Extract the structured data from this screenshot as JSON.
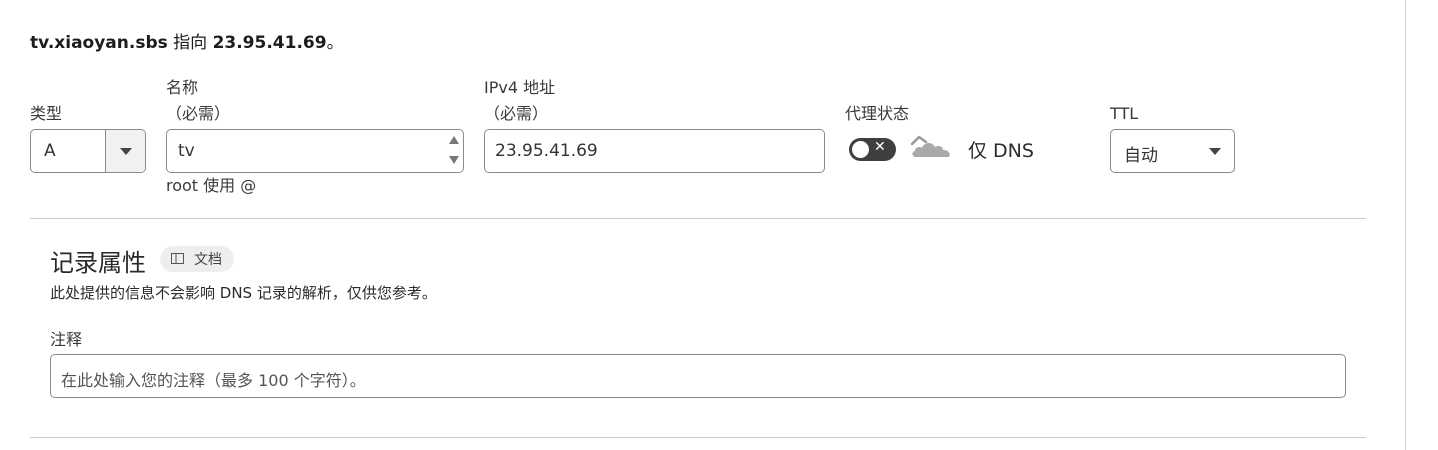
{
  "summary": {
    "host": "tv.xiaoyan.sbs",
    "points_to": "指向",
    "ip": "23.95.41.69",
    "end": "。"
  },
  "type_field": {
    "label": "类型",
    "value": "A",
    "icon": "chevron-down-icon"
  },
  "name_field": {
    "label": "名称",
    "required": "（必需）",
    "value": "tv",
    "hint": "root 使用 @",
    "icon": "spinner-arrows-icon"
  },
  "ipv4_field": {
    "label": "IPv4 地址",
    "required": "（必需）",
    "value": "23.95.41.69"
  },
  "proxy": {
    "label": "代理状态",
    "toggle_off_symbol": "✕",
    "status_text": "仅 DNS",
    "cloud_color": "#9a9a9a",
    "enabled": false
  },
  "ttl_field": {
    "label": "TTL",
    "value": "自动",
    "icon": "chevron-down-icon"
  },
  "record_attributes": {
    "title": "记录属性",
    "docs_badge": "文档",
    "description": "此处提供的信息不会影响 DNS 记录的解析，仅供您参考。",
    "notes_label": "注释",
    "notes_placeholder": "在此处输入您的注释（最多 100 个字符）。"
  },
  "colors": {
    "toggle_bg": "#3f3f3f",
    "border": "#8a8a8a",
    "divider": "#c9c9c9",
    "badge_bg": "#eeeeee"
  }
}
